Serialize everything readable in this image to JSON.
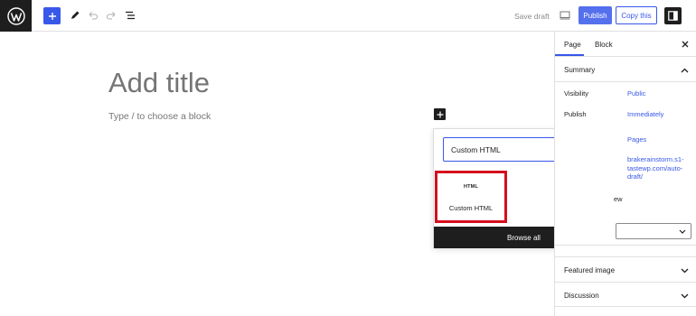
{
  "topbar": {
    "logo_icon": "wordpress-logo-icon",
    "add_icon": "plus-icon",
    "tools_icon": "pencil-icon",
    "undo_icon": "undo-icon",
    "redo_icon": "redo-icon",
    "outline_icon": "list-view-icon",
    "save_draft": "Save draft",
    "preview_icon": "desktop-preview-icon",
    "publish": "Publish",
    "copy": "Copy this",
    "settings_icon": "settings-panel-icon"
  },
  "editor": {
    "title_placeholder": "Add title",
    "block_placeholder": "Type / to choose a block",
    "inline_add_icon": "plus-icon"
  },
  "inserter": {
    "search_value": "Custom HTML",
    "clear_icon": "close-icon",
    "result": {
      "icon_text": "HTML",
      "label": "Custom HTML"
    },
    "browse_all": "Browse all",
    "highlight_color": "#d5101e"
  },
  "sidebar": {
    "tabs": {
      "page": "Page",
      "block": "Block"
    },
    "close_icon": "close-icon",
    "summary": {
      "title": "Summary",
      "rows": [
        {
          "label": "Visibility",
          "value": "Public"
        },
        {
          "label": "Publish",
          "value": "Immediately"
        },
        {
          "label": "",
          "value": "Pages"
        },
        {
          "label": "",
          "value": "brakerainstorm.s1-tastewp.com/auto-draft/"
        }
      ],
      "review_text": "ew"
    },
    "panels": [
      "Featured image",
      "Discussion"
    ]
  },
  "colors": {
    "accent": "#3858e9",
    "dark": "#1e1e1e"
  }
}
